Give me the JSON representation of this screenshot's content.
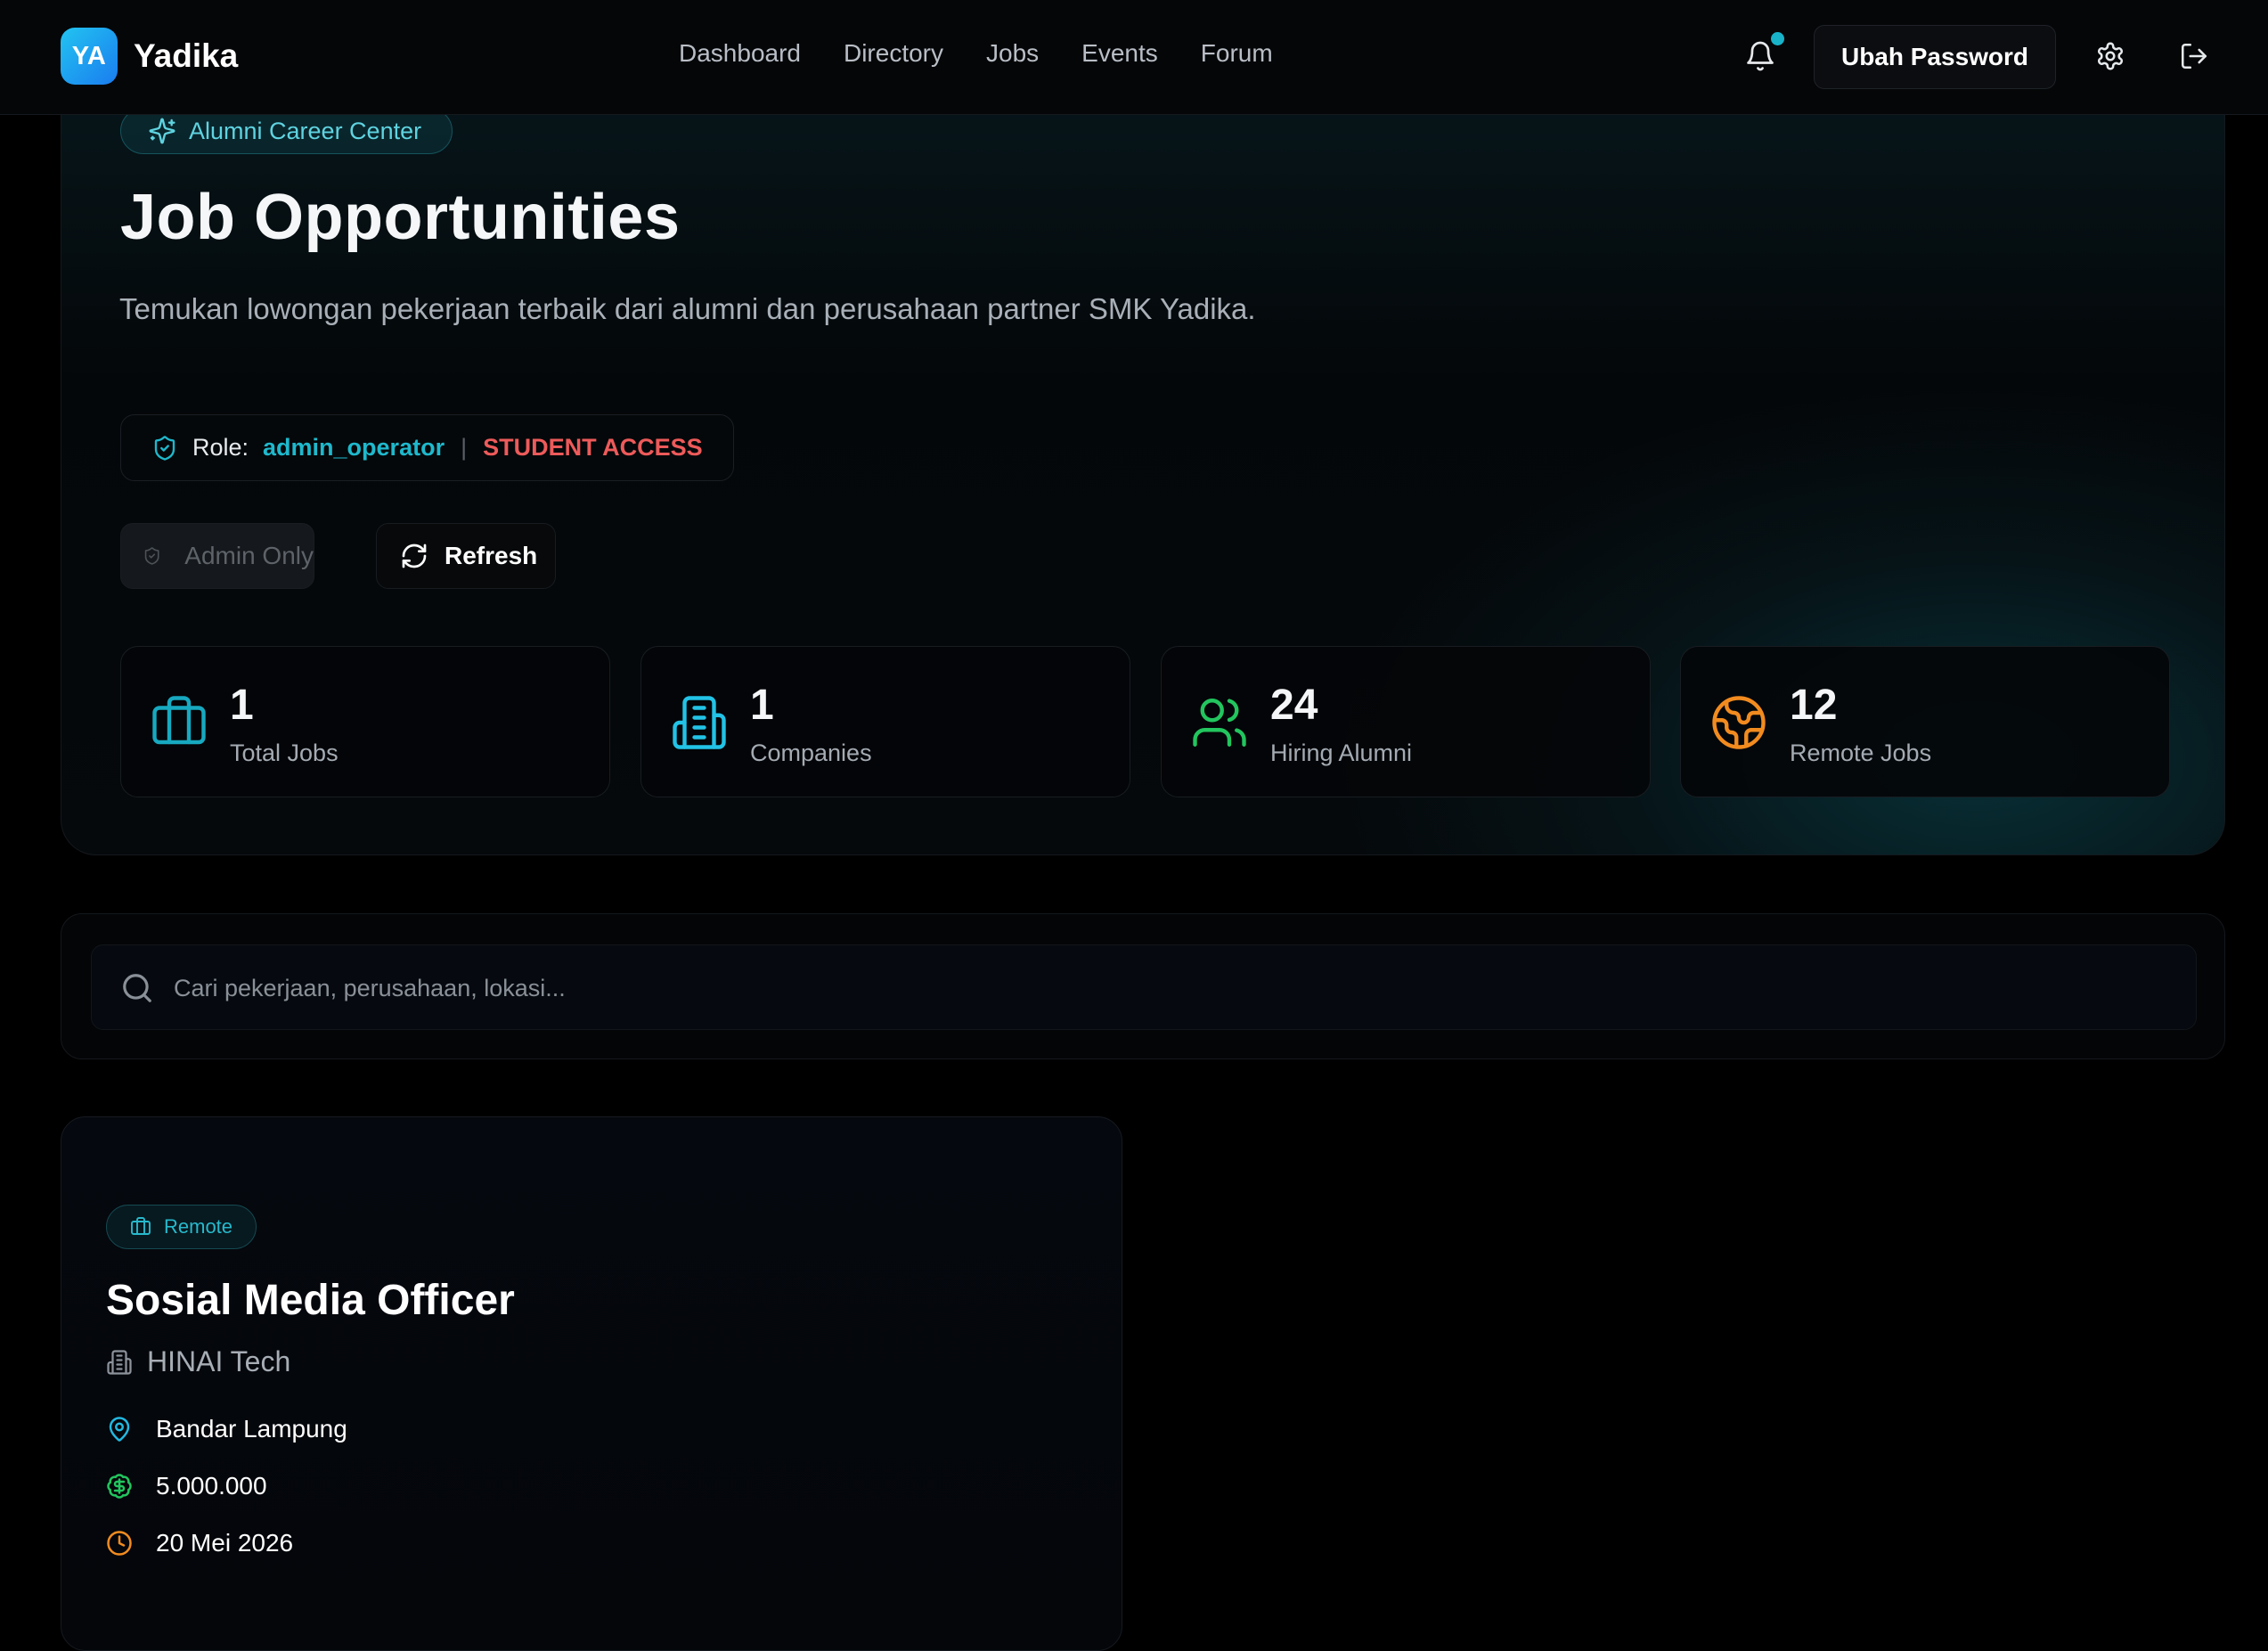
{
  "header": {
    "logo_text": "YA",
    "brand": "Yadika",
    "nav": [
      "Dashboard",
      "Directory",
      "Jobs",
      "Events",
      "Forum"
    ],
    "change_password": "Ubah Password"
  },
  "hero": {
    "pill": "Alumni Career Center",
    "title": "Job Opportunities",
    "description": "Temukan lowongan pekerjaan terbaik dari alumni dan perusahaan partner SMK Yadika.",
    "role_label": "Role:",
    "role_value": "admin_operator",
    "role_separator": "|",
    "access": "STUDENT ACCESS",
    "admin_button": "Admin Only",
    "refresh_button": "Refresh"
  },
  "stats": [
    {
      "value": "1",
      "label": "Total Jobs",
      "icon": "briefcase-icon",
      "color": "#17a9c0"
    },
    {
      "value": "1",
      "label": "Companies",
      "icon": "building-icon",
      "color": "#22c3e6"
    },
    {
      "value": "24",
      "label": "Hiring Alumni",
      "icon": "users-icon",
      "color": "#22c55e"
    },
    {
      "value": "12",
      "label": "Remote Jobs",
      "icon": "globe-icon",
      "color": "#f28b1f"
    }
  ],
  "search": {
    "placeholder": "Cari pekerjaan, perusahaan, lokasi..."
  },
  "job": {
    "badge": "Remote",
    "title": "Sosial Media Officer",
    "company": "HINAI Tech",
    "location": "Bandar Lampung",
    "salary": "5.000.000",
    "deadline": "20 Mei 2026"
  },
  "colors": {
    "accent": "#1fb8cc",
    "danger": "#ee5a5a",
    "background": "#000000"
  }
}
